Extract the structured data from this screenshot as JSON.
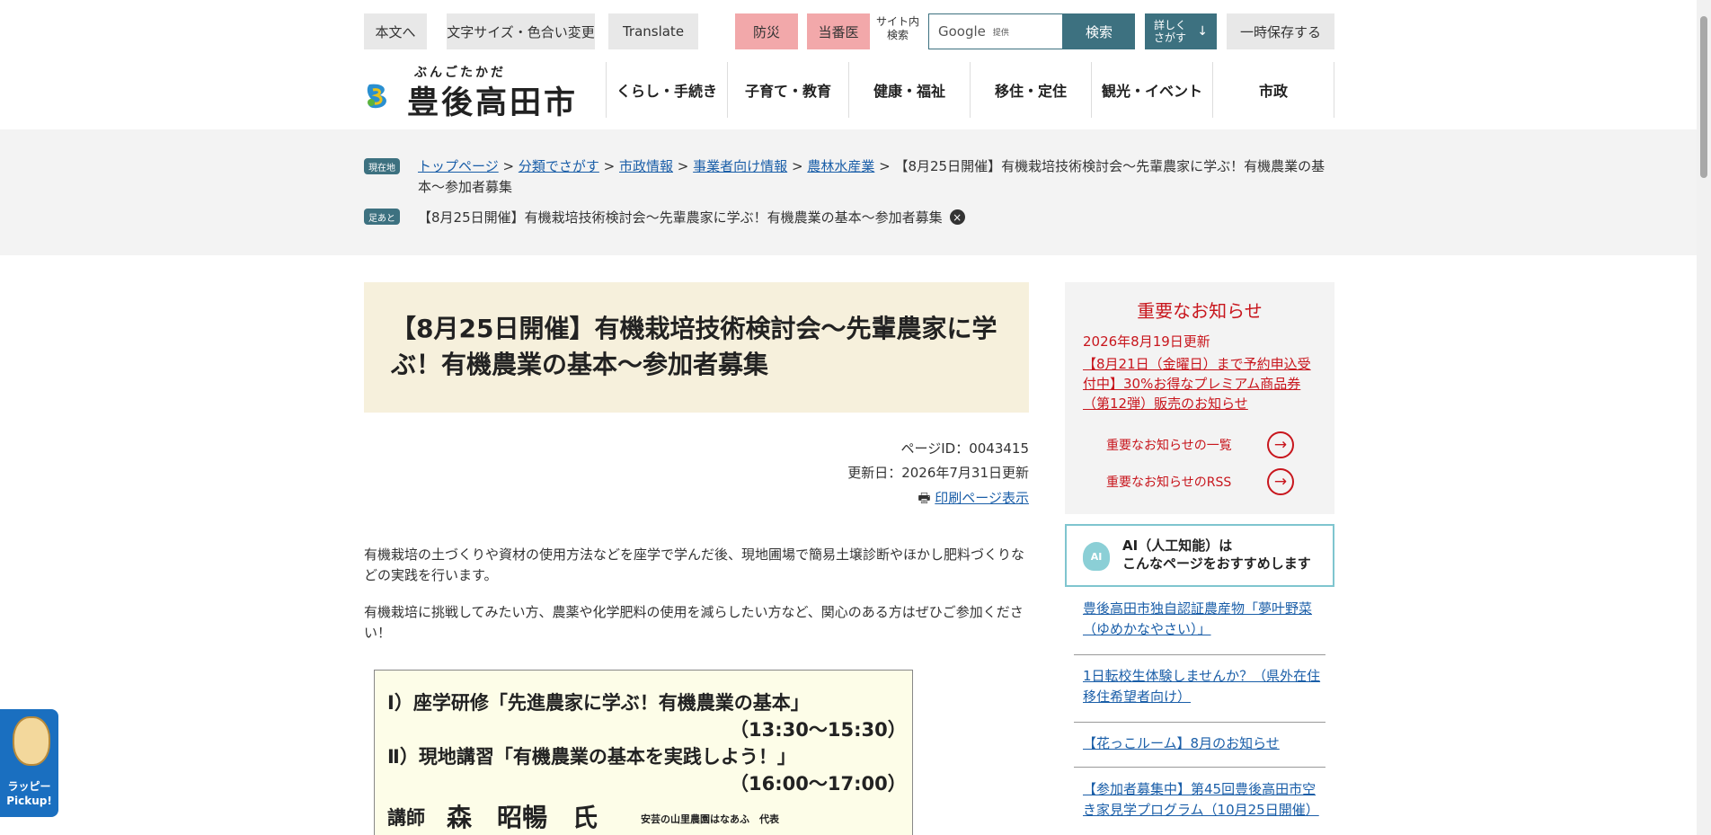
{
  "utility": {
    "skip": "本文へ",
    "text_size": "文字サイズ・色合い変更",
    "translate": "Translate",
    "disaster": "防災",
    "duty_doctor": "当番医",
    "site_search_line1": "サイト内",
    "site_search_line2": "検索",
    "search_placeholder": "Google",
    "search_powered": "提供",
    "search_button": "検索",
    "detail_line1": "詳しく",
    "detail_line2": "さがす",
    "save": "一時保存する"
  },
  "logo": {
    "ruby": "ぶんごたかだ",
    "name": "豊後高田市"
  },
  "nav": [
    "くらし・手続き",
    "子育て・教育",
    "健康・福祉",
    "移住・定住",
    "観光・イベント",
    "市政"
  ],
  "breadcrumb": {
    "current_tag": "現在地",
    "links": [
      "トップページ",
      "分類でさがす",
      "市政情報",
      "事業者向け情報",
      "農林水産業"
    ],
    "sep": ">",
    "current": "【8月25日開催】有機栽培技術検討会～先輩農家に学ぶ！有機農業の基本～参加者募集",
    "history_tag": "足あと",
    "history_item": "【8月25日開催】有機栽培技術検討会～先輩農家に学ぶ！有機農業の基本～参加者募集"
  },
  "article": {
    "title": "【8月25日開催】有機栽培技術検討会～先輩農家に学ぶ！有機農業の基本～参加者募集",
    "page_id": "ページID：0043415",
    "updated": "更新日：2026年7月31日更新",
    "print": "印刷ページ表示",
    "p1": "有機栽培の土づくりや資材の使用方法などを座学で学んだ後、現地圃場で簡易土壌診断やほかし肥料づくりなどの実践を行います。",
    "p2": "有機栽培に挑戦してみたい方、農薬や化学肥料の使用を減らしたい方など、関心のある方はぜひご参加ください！",
    "flyer": {
      "line1": "Ⅰ）座学研修「先進農家に学ぶ！有機農業の基本」",
      "time1": "（13:30～15:30）",
      "line2": "Ⅱ）現地講習「有機農業の基本を実践しよう！」",
      "time2": "（16:00～17:00）",
      "lecturer_label": "講師",
      "lecturer_name": "森　昭暢　氏",
      "lecturer_org": "安芸の山里農園はなあふ　代表"
    }
  },
  "notice": {
    "title": "重要なお知らせ",
    "date": "2026年8月19日更新",
    "link": "【8月21日（金曜日）まで予約申込受付中】30%お得なプレミアム商品券（第12弾）販売のお知らせ",
    "list": "重要なお知らせの一覧",
    "rss": "重要なお知らせのRSS"
  },
  "ai": {
    "badge": "AI",
    "line1": "AI（人工知能）は",
    "line2": "こんなページをおすすめします",
    "items": [
      "豊後高田市独自認証農産物「夢叶野菜（ゆめかなやさい）」",
      "1日転校生体験しませんか？（県外在住移住希望者向け）",
      "【花っこルーム】8月のお知らせ",
      "【参加者募集中】第45回豊後高田市空き家見学プログラム（10月25日開催）"
    ]
  },
  "pickup": {
    "line1": "ラッピー",
    "line2": "Pickup!"
  }
}
